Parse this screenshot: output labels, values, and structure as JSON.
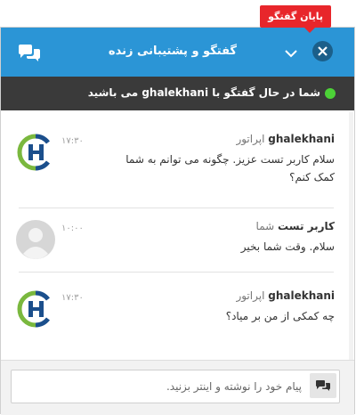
{
  "tooltip": {
    "label": "پایان گفتگو"
  },
  "header": {
    "title": "گفتگو و پشتیبانی زنده"
  },
  "status": {
    "text": "شما در حال گفتگو با ghalekhani می باشید"
  },
  "messages": [
    {
      "name": "ghalekhani",
      "role": "اپراتور",
      "time": "۱۷:۳۰",
      "body": "سلام کاربر تست عزیز. چگونه می توانم به شما کمک کنم؟",
      "avatar": "logo"
    },
    {
      "name": "کاربر تست",
      "role": "شما",
      "time": "۱۰:۰۰",
      "body": "سلام. وقت شما بخیر",
      "avatar": "user"
    },
    {
      "name": "ghalekhani",
      "role": "اپراتور",
      "time": "۱۷:۳۰",
      "body": "چه کمکی از من بر میاد؟",
      "avatar": "logo"
    }
  ],
  "composer": {
    "placeholder": "پیام خود را نوشته و اینتر بزنید."
  },
  "icons": {
    "header": "chat-bubbles-icon",
    "minimize": "chevron-down-icon",
    "close": "close-icon",
    "send": "chat-send-icon"
  },
  "colors": {
    "header": "#2b95d6",
    "status_bar": "#3a3a3a",
    "online": "#4cd137",
    "tooltip": "#e8262b"
  }
}
